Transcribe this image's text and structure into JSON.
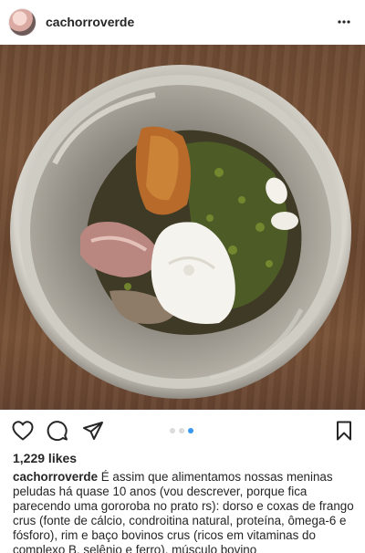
{
  "post": {
    "username": "cachorroverde",
    "avatar_icon": "profile-avatar",
    "more_icon": "more-options-icon",
    "likes": "1,229 likes",
    "caption_user": "cachorroverde",
    "caption_text": " É assim que alimentamos  nossas meninas peludas há quase 10 anos (vou descrever, porque fica parecendo uma gororoba no prato rs): dorso e coxas de frango crus (fonte de cálcio, condroitina natural, proteína, ômega-6 e fósforo), rim e baço bovinos crus (ricos em vitaminas do complexo B, selênio e ferro), músculo bovino"
  },
  "actions": {
    "like_icon": "heart-icon",
    "comment_icon": "comment-icon",
    "share_icon": "share-icon",
    "save_icon": "bookmark-icon"
  },
  "carousel": {
    "slides": 3,
    "active": 3
  },
  "colors": {
    "accent": "#3897f0",
    "text": "#262626",
    "dot_inactive": "#dbdbdb"
  }
}
